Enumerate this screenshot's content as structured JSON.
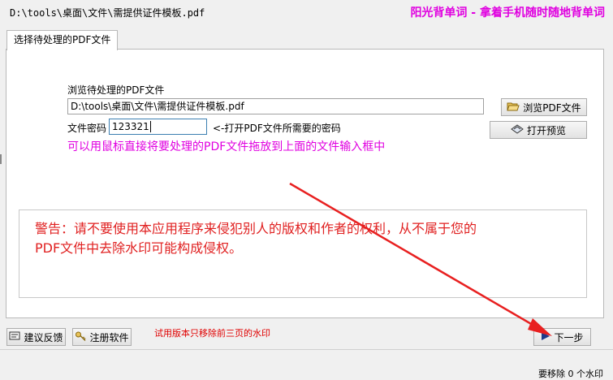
{
  "header": {
    "file_path": "D:\\tools\\桌面\\文件\\需提供证件模板.pdf",
    "slogan": "阳光背单词 - 拿着手机随时随地背单词"
  },
  "tab": {
    "label": "选择待处理的PDF文件"
  },
  "form": {
    "browse_label": "浏览待处理的PDF文件",
    "file_path_value": "D:\\tools\\桌面\\文件\\需提供证件模板.pdf",
    "password_label": "文件密码",
    "password_value": "123321",
    "password_hint": "<-打开PDF文件所需要的密码",
    "drag_hint": "可以用鼠标直接将要处理的PDF文件拖放到上面的文件输入框中"
  },
  "buttons": {
    "browse": "浏览PDF文件",
    "preview": "打开预览",
    "feedback": "建议反馈",
    "register": "注册软件",
    "next": "下一步"
  },
  "warning": {
    "line1": "警告：请不要使用本应用程序来侵犯别人的版权和作者的权利，从不属于您的",
    "line2": "PDF文件中去除水印可能构成侵权。"
  },
  "trial_notice": "试用版本只移除前三页的水印",
  "status": {
    "text": "要移除 0 个水印"
  },
  "colors": {
    "accent_magenta": "#e000e0",
    "warning_red": "#e02020",
    "arrow_red": "#e82020"
  }
}
